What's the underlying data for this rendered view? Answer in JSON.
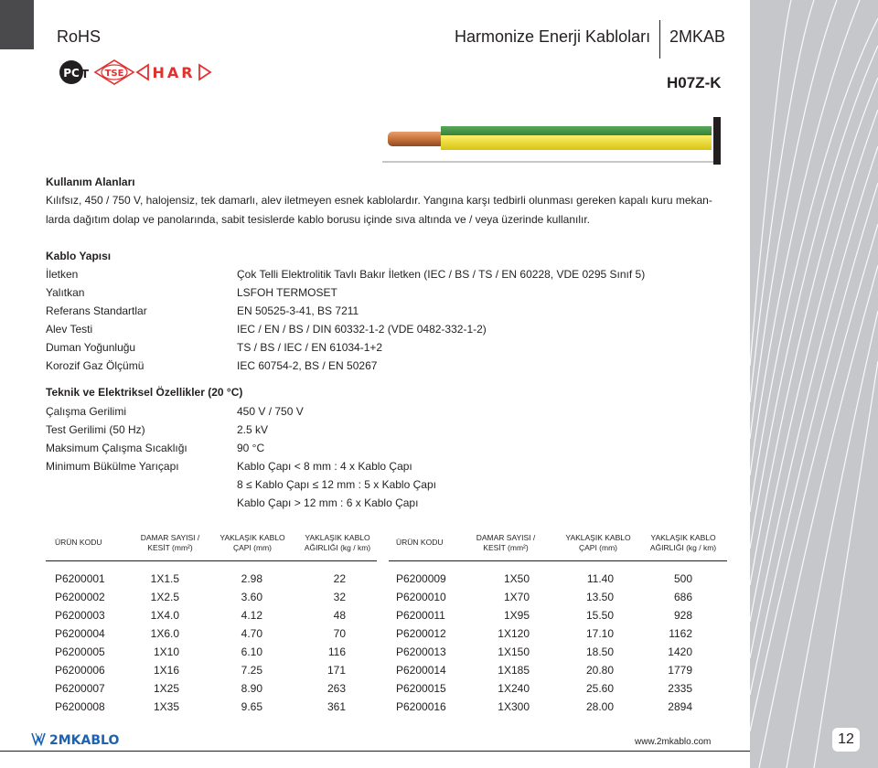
{
  "header": {
    "rohs": "RoHS",
    "title": "Harmonize Enerji Kabloları",
    "brand": "2MKAB",
    "model": "H07Z-K"
  },
  "certifications": {
    "pct": "PCT",
    "tse": "TSE",
    "har": "HAR"
  },
  "usage": {
    "title": "Kullanım Alanları",
    "line1": "Kılıfsız, 450 / 750 V, halojensiz, tek damarlı, alev iletmeyen esnek kablolardır. Yangına karşı tedbirli olunması gereken kapalı kuru mekan-",
    "line2": "larda dağıtım dolap ve panolarında, sabit tesislerde kablo borusu içinde sıva altında ve / veya üzerinde kullanılır."
  },
  "construction": {
    "title": "Kablo Yapısı",
    "rows": [
      {
        "label": "İletken",
        "value": "Çok Telli Elektrolitik Tavlı Bakır İletken (IEC / BS / TS / EN 60228, VDE 0295 Sınıf 5)"
      },
      {
        "label": "Yalıtkan",
        "value": "LSFOH TERMOSET"
      },
      {
        "label": "Referans Standartlar",
        "value": "EN 50525-3-41, BS 7211"
      },
      {
        "label": "Alev Testi",
        "value": "IEC / EN / BS / DIN 60332-1-2 (VDE 0482-332-1-2)"
      },
      {
        "label": "Duman Yoğunluğu",
        "value": "TS / BS / IEC / EN 61034-1+2"
      },
      {
        "label": "Korozif Gaz Ölçümü",
        "value": "IEC 60754-2, BS / EN 50267"
      }
    ]
  },
  "technical": {
    "title": "Teknik ve Elektriksel Özellikler (20 °C)",
    "rows": [
      {
        "label": "Çalışma Gerilimi",
        "value": "450 V / 750 V"
      },
      {
        "label": "Test Gerilimi (50 Hz)",
        "value": "2.5 kV"
      },
      {
        "label": "Maksimum Çalışma Sıcaklığı",
        "value": "90 °C"
      },
      {
        "label": "Minimum Bükülme Yarıçapı",
        "value": "Kablo Çapı < 8 mm : 4 x Kablo Çapı"
      },
      {
        "label": "",
        "value": "8 ≤ Kablo Çapı ≤ 12 mm : 5 x Kablo Çapı"
      },
      {
        "label": "",
        "value": "Kablo Çapı > 12 mm : 6 x Kablo Çapı"
      }
    ]
  },
  "table": {
    "headers": {
      "code": "ÜRÜN KODU",
      "cores_l1": "DAMAR SAYISI /",
      "cores_l2": "KESİT (mm²)",
      "dia_l1": "YAKLAŞIK KABLO",
      "dia_l2": "ÇAPI (mm)",
      "wt_l1": "YAKLAŞIK KABLO",
      "wt_l2": "AĞIRLIĞI (kg / km)"
    },
    "left": [
      {
        "code": "P6200001",
        "section": "1X1.5",
        "diameter": "2.98",
        "weight": "22"
      },
      {
        "code": "P6200002",
        "section": "1X2.5",
        "diameter": "3.60",
        "weight": "32"
      },
      {
        "code": "P6200003",
        "section": "1X4.0",
        "diameter": "4.12",
        "weight": "48"
      },
      {
        "code": "P6200004",
        "section": "1X6.0",
        "diameter": "4.70",
        "weight": "70"
      },
      {
        "code": "P6200005",
        "section": "1X10",
        "diameter": "6.10",
        "weight": "116"
      },
      {
        "code": "P6200006",
        "section": "1X16",
        "diameter": "7.25",
        "weight": "171"
      },
      {
        "code": "P6200007",
        "section": "1X25",
        "diameter": "8.90",
        "weight": "263"
      },
      {
        "code": "P6200008",
        "section": "1X35",
        "diameter": "9.65",
        "weight": "361"
      }
    ],
    "right": [
      {
        "code": "P6200009",
        "section": "1X50",
        "diameter": "11.40",
        "weight": "500"
      },
      {
        "code": "P6200010",
        "section": "1X70",
        "diameter": "13.50",
        "weight": "686"
      },
      {
        "code": "P6200011",
        "section": "1X95",
        "diameter": "15.50",
        "weight": "928"
      },
      {
        "code": "P6200012",
        "section": "1X120",
        "diameter": "17.10",
        "weight": "1162"
      },
      {
        "code": "P6200013",
        "section": "1X150",
        "diameter": "18.50",
        "weight": "1420"
      },
      {
        "code": "P6200014",
        "section": "1X185",
        "diameter": "20.80",
        "weight": "1779"
      },
      {
        "code": "P6200015",
        "section": "1X240",
        "diameter": "25.60",
        "weight": "2335"
      },
      {
        "code": "P6200016",
        "section": "1X300",
        "diameter": "28.00",
        "weight": "2894"
      }
    ]
  },
  "footer": {
    "logo": "2MKABLO",
    "url": "www.2mkablo.com",
    "page": "12"
  },
  "colors": {
    "strip": "#c6c7cb",
    "accent_red": "#e0312f",
    "cable_green": "#3d8b3f",
    "cable_yellow": "#f2e21e",
    "copper": "#c8733d"
  }
}
